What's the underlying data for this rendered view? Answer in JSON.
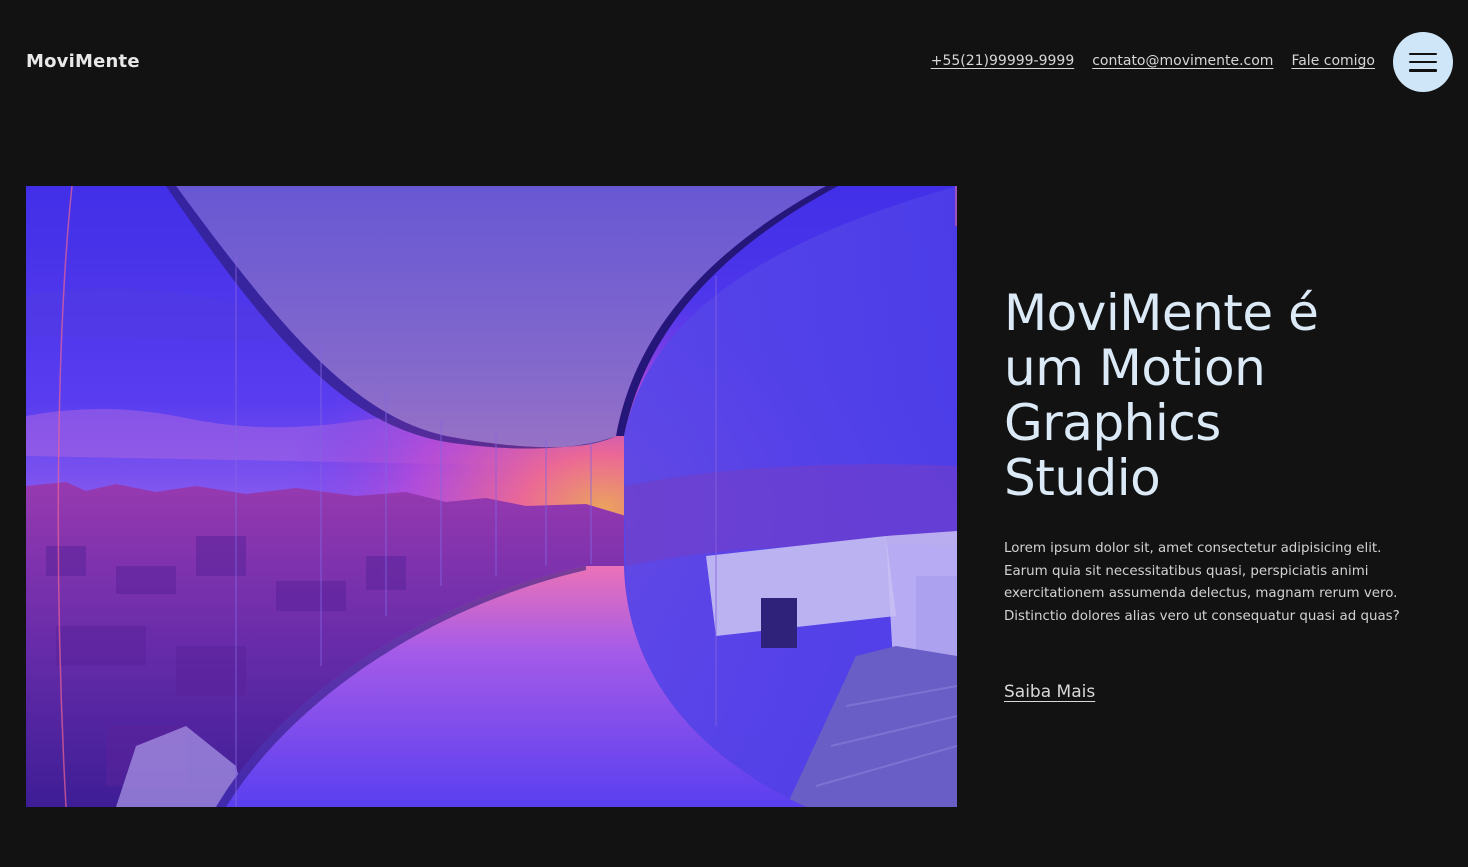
{
  "header": {
    "logo": "MoviMente",
    "links": {
      "phone": "+55(21)99999-9999",
      "email": "contato@movimente.com",
      "contact": "Fale comigo"
    },
    "menu_icon": "hamburger-menu-icon"
  },
  "hero": {
    "title_lines": [
      "MoviMente é",
      "um Motion",
      "Graphics",
      "Studio"
    ],
    "description": "Lorem ipsum dolor sit, amet consectetur adipisicing elit. Earum quia sit necessitatibus quasi, perspiciatis animi exercitationem assumenda delectus, magnam rerum vero. Distinctio dolores alias vero ut consequatur quasi ad quas?",
    "cta_label": "Saiba Mais"
  },
  "colors": {
    "background": "#121212",
    "menu_button": "#cfe6f8",
    "title": "#dbeaf6",
    "image_tint": "#6a4cf5"
  }
}
